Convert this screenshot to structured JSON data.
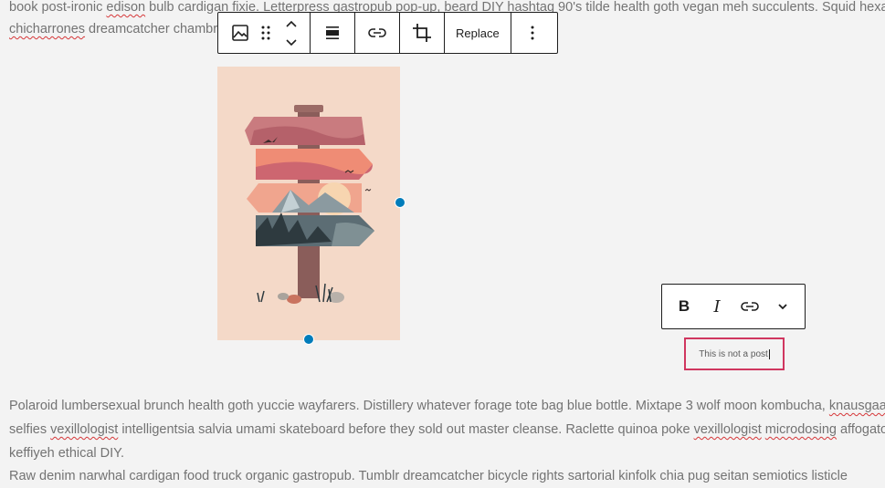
{
  "paragraph_top": {
    "line1": [
      "book post-ironic ",
      "edison",
      " bulb cardigan fixie. Letterpress gastropub pop-up, beard DIY hashtag 90's tilde health goth vegan meh succulents. Squid hexagon"
    ],
    "line2": [
      "chicharrones",
      " dreamcatcher chambray"
    ]
  },
  "block_toolbar": {
    "icons": [
      "image-icon",
      "drag-handle-icon",
      "move-up-icon",
      "move-down-icon",
      "align-icon",
      "link-icon",
      "crop-icon",
      "more-options-icon"
    ],
    "replace_label": "Replace"
  },
  "format_toolbar": {
    "bold_label": "B",
    "italic_label": "I",
    "icons": [
      "link-icon",
      "chevron-down-icon"
    ]
  },
  "caption": {
    "text": "This is not a post"
  },
  "paragraph_bottom": {
    "line1": [
      "Polaroid lumbersexual brunch health goth yuccie wayfarers. Distillery whatever forage tote bag blue bottle. Mixtape 3 wolf moon kombucha, ",
      "knausgaard"
    ],
    "line2": [
      "selfies ",
      "vexillologist",
      " intelligentsia salvia umami skateboard before they sold out master cleanse. Raclette quinoa poke ",
      "vexillologist",
      " ",
      "microdosing",
      " affogato"
    ],
    "line3": [
      "keffiyeh ethical DIY."
    ],
    "line4": [
      "Raw denim narwhal cardigan food truck organic gastropub. Tumblr dreamcatcher bicycle rights sartorial kinfolk chia pug seitan semiotics listicle"
    ]
  },
  "colors": {
    "accent": "#007cba",
    "caption_border": "#d0365f",
    "background": "#f3f3f3"
  }
}
